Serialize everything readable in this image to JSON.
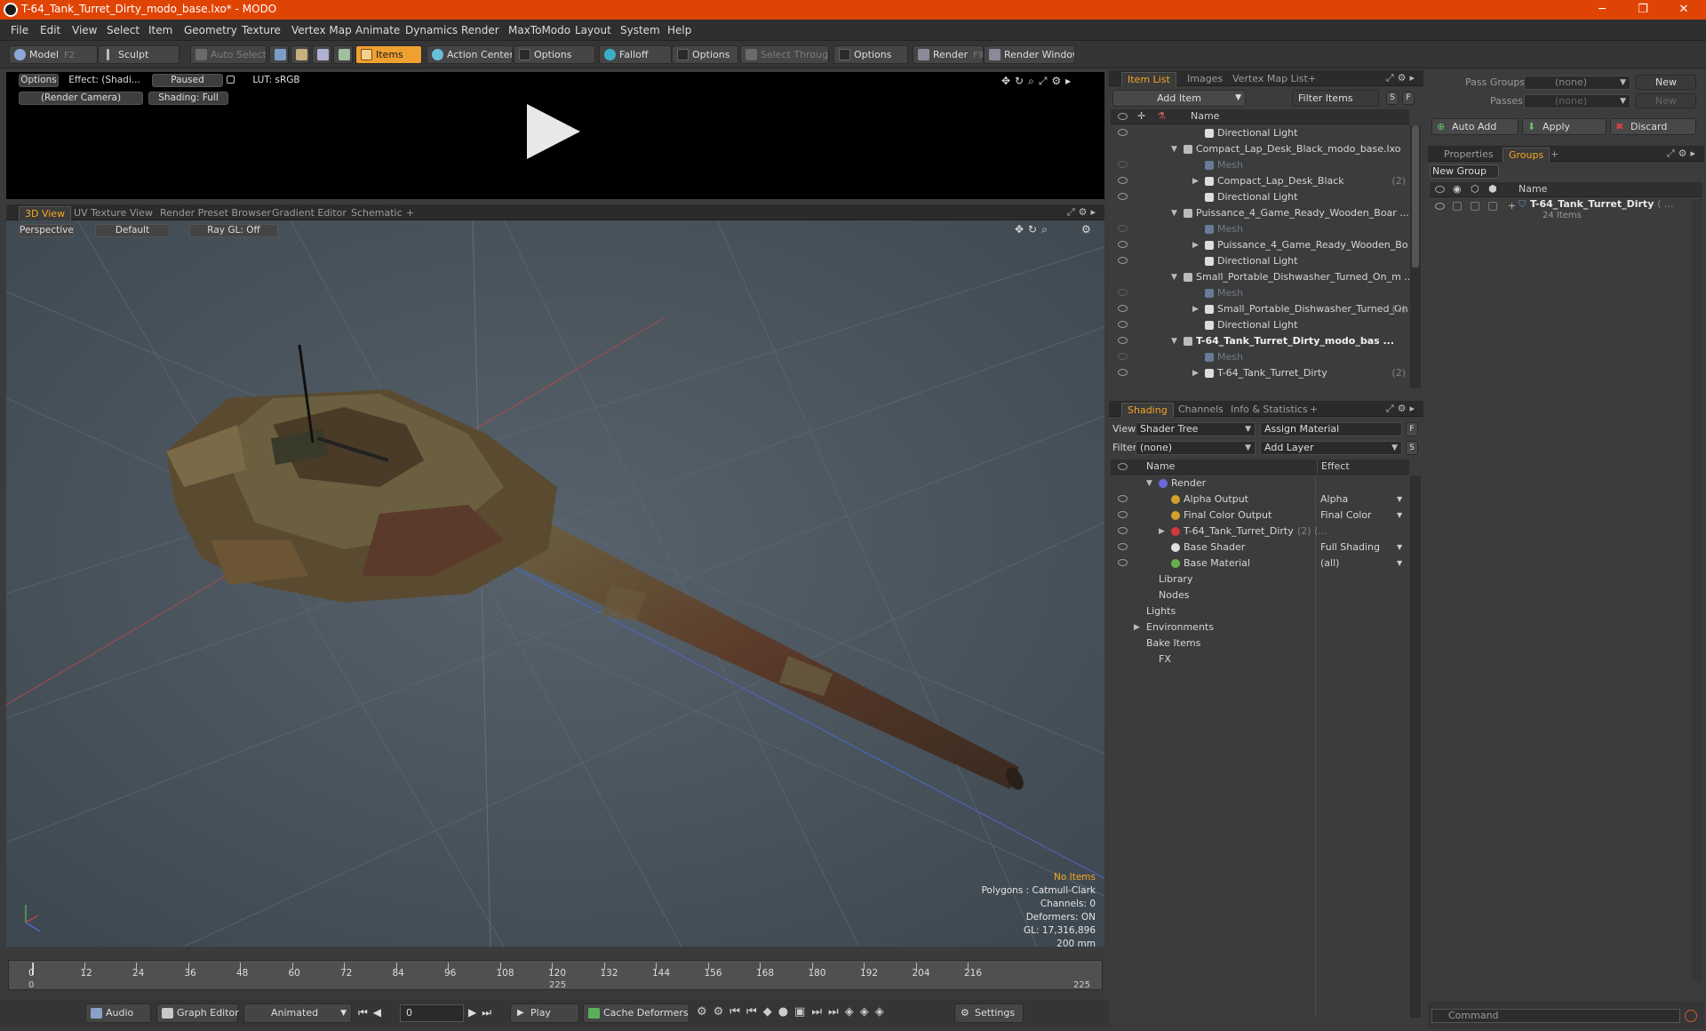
{
  "window": {
    "title": "T-64_Tank_Turret_Dirty_modo_base.lxo* - MODO",
    "minimize": "─",
    "restore": "❐",
    "close": "✕"
  },
  "menu": [
    "File",
    "Edit",
    "View",
    "Select",
    "Item",
    "Geometry",
    "Texture",
    "Vertex Map",
    "Animate",
    "Dynamics",
    "Render",
    "MaxToModo",
    "Layout",
    "System",
    "Help"
  ],
  "toolbar": {
    "model": "Model",
    "model_key": "F2",
    "sculpt": "Sculpt",
    "auto_select": "Auto Select",
    "items": "Items",
    "action_center": "Action Center",
    "options1": "Options",
    "falloff": "Falloff",
    "options2": "Options",
    "select_through": "Select Through",
    "options3": "Options",
    "render": "Render",
    "render_key": "F9",
    "render_window": "Render Window"
  },
  "preview": {
    "options": "Options",
    "effect": "Effect: (Shadi...",
    "paused": "Paused",
    "lut": "LUT: sRGB",
    "camera": "(Render Camera)",
    "shading": "Shading: Full"
  },
  "viewport_tabs": [
    "3D View",
    "UV Texture View",
    "Render Preset Browser",
    "Gradient Editor",
    "Schematic",
    "+"
  ],
  "viewport": {
    "perspective": "Perspective",
    "default": "Default",
    "raygl": "Ray GL: Off",
    "hud": {
      "no_items": "No Items",
      "polygons": "Polygons : Catmull-Clark",
      "channels": "Channels: 0",
      "deformers": "Deformers: ON",
      "gl": "GL: 17,316,896",
      "scale": "200 mm"
    }
  },
  "timeline": {
    "ticks": [
      "0",
      "12",
      "24",
      "36",
      "48",
      "60",
      "72",
      "84",
      "96",
      "108",
      "120",
      "132",
      "144",
      "156",
      "168",
      "180",
      "192",
      "204",
      "216"
    ],
    "start": "0",
    "mid": "225",
    "end": "225"
  },
  "bottom": {
    "audio": "Audio",
    "graph_editor": "Graph Editor",
    "animated": "Animated",
    "frame": "0",
    "play": "Play",
    "cache_deformers": "Cache Deformers",
    "settings": "Settings"
  },
  "item_list": {
    "tabs": [
      "Item List",
      "Images",
      "Vertex Map List",
      "+"
    ],
    "add_item": "Add Item",
    "filter_items": "Filter Items",
    "s": "S",
    "f": "F",
    "col_name": "Name",
    "rows": [
      {
        "label": "Directional Light",
        "count": "",
        "indent": 3,
        "exp": "",
        "dim": false,
        "bold": false,
        "eye": true
      },
      {
        "label": "Compact_Lap_Desk_Black_modo_base.lxo",
        "count": "",
        "indent": 1,
        "exp": "▼",
        "dim": false,
        "bold": false,
        "eye": false
      },
      {
        "label": "Mesh",
        "count": "",
        "indent": 3,
        "exp": "",
        "dim": true,
        "bold": false,
        "eye": true
      },
      {
        "label": "Compact_Lap_Desk_Black",
        "count": "(2)",
        "indent": 3,
        "exp": "▶",
        "dim": false,
        "bold": false,
        "eye": true
      },
      {
        "label": "Directional Light",
        "count": "",
        "indent": 3,
        "exp": "",
        "dim": false,
        "bold": false,
        "eye": true
      },
      {
        "label": "Puissance_4_Game_Ready_Wooden_Boar ...",
        "count": "",
        "indent": 1,
        "exp": "▼",
        "dim": false,
        "bold": false,
        "eye": false
      },
      {
        "label": "Mesh",
        "count": "",
        "indent": 3,
        "exp": "",
        "dim": true,
        "bold": false,
        "eye": true
      },
      {
        "label": "Puissance_4_Game_Ready_Wooden_Bo ...",
        "count": "",
        "indent": 3,
        "exp": "▶",
        "dim": false,
        "bold": false,
        "eye": true
      },
      {
        "label": "Directional Light",
        "count": "",
        "indent": 3,
        "exp": "",
        "dim": false,
        "bold": false,
        "eye": true
      },
      {
        "label": "Small_Portable_Dishwasher_Turned_On_m ...",
        "count": "",
        "indent": 1,
        "exp": "▼",
        "dim": false,
        "bold": false,
        "eye": false
      },
      {
        "label": "Mesh",
        "count": "",
        "indent": 3,
        "exp": "",
        "dim": true,
        "bold": false,
        "eye": true
      },
      {
        "label": "Small_Portable_Dishwasher_Turned_On",
        "count": "(2)",
        "indent": 3,
        "exp": "▶",
        "dim": false,
        "bold": false,
        "eye": true
      },
      {
        "label": "Directional Light",
        "count": "",
        "indent": 3,
        "exp": "",
        "dim": false,
        "bold": false,
        "eye": true
      },
      {
        "label": "T-64_Tank_Turret_Dirty_modo_bas ...",
        "count": "",
        "indent": 1,
        "exp": "▼",
        "dim": false,
        "bold": true,
        "eye": true
      },
      {
        "label": "Mesh",
        "count": "",
        "indent": 3,
        "exp": "",
        "dim": true,
        "bold": false,
        "eye": true
      },
      {
        "label": "T-64_Tank_Turret_Dirty",
        "count": "(2)",
        "indent": 3,
        "exp": "▶",
        "dim": false,
        "bold": false,
        "eye": true
      }
    ]
  },
  "shading": {
    "tabs": [
      "Shading",
      "Channels",
      "Info & Statistics",
      "+"
    ],
    "view_label": "View",
    "view_value": "Shader Tree",
    "assign_material": "Assign Material",
    "f": "F",
    "filter_label": "Filter",
    "filter_value": "(none)",
    "add_layer": "Add Layer",
    "s": "S",
    "col_name": "Name",
    "col_effect": "Effect",
    "rows": [
      {
        "label": "Render",
        "effect": "",
        "indent": 1,
        "exp": "▼",
        "icon": "#6a6adf",
        "eye": false
      },
      {
        "label": "Alpha Output",
        "effect": "Alpha",
        "indent": 2,
        "exp": "",
        "icon": "#d4a030",
        "eye": true
      },
      {
        "label": "Final Color Output",
        "effect": "Final Color",
        "indent": 2,
        "exp": "",
        "icon": "#d4a030",
        "eye": true
      },
      {
        "label": "T-64_Tank_Turret_Dirty",
        "effect": "",
        "indent": 2,
        "exp": "▶",
        "icon": "#d03a3a",
        "eye": true,
        "extra": "(2) (..."
      },
      {
        "label": "Base Shader",
        "effect": "Full Shading",
        "indent": 2,
        "exp": "",
        "icon": "#e0e0e0",
        "eye": true
      },
      {
        "label": "Base Material",
        "effect": "(all)",
        "indent": 2,
        "exp": "",
        "icon": "#6ab04a",
        "eye": true
      },
      {
        "label": "Library",
        "effect": "",
        "indent": 1,
        "exp": "",
        "icon": "",
        "eye": false
      },
      {
        "label": "Nodes",
        "effect": "",
        "indent": 1,
        "exp": "",
        "icon": "",
        "eye": false
      },
      {
        "label": "Lights",
        "effect": "",
        "indent": 0,
        "exp": "",
        "icon": "",
        "eye": false
      },
      {
        "label": "Environments",
        "effect": "",
        "indent": 0,
        "exp": "▶",
        "icon": "",
        "eye": false
      },
      {
        "label": "Bake Items",
        "effect": "",
        "indent": 0,
        "exp": "",
        "icon": "",
        "eye": false
      },
      {
        "label": "FX",
        "effect": "",
        "indent": 1,
        "exp": "",
        "icon": "",
        "eye": false
      }
    ]
  },
  "groups": {
    "pass_groups_label": "Pass Groups",
    "pass_groups_value": "(none)",
    "new": "New",
    "passes_label": "Passes",
    "passes_value": "(none)",
    "new2": "New",
    "auto_add": "Auto Add",
    "apply": "Apply",
    "discard": "Discard",
    "tabs": [
      "Properties",
      "Groups",
      "+"
    ],
    "new_group": "New Group",
    "col_name": "Name",
    "group_name": "T-64_Tank_Turret_Dirty",
    "group_suffix": "( ...",
    "group_count": "24 Items"
  },
  "command": {
    "placeholder": "Command"
  },
  "colors": {
    "accent": "#f5a623",
    "titlebar": "#e04404"
  }
}
